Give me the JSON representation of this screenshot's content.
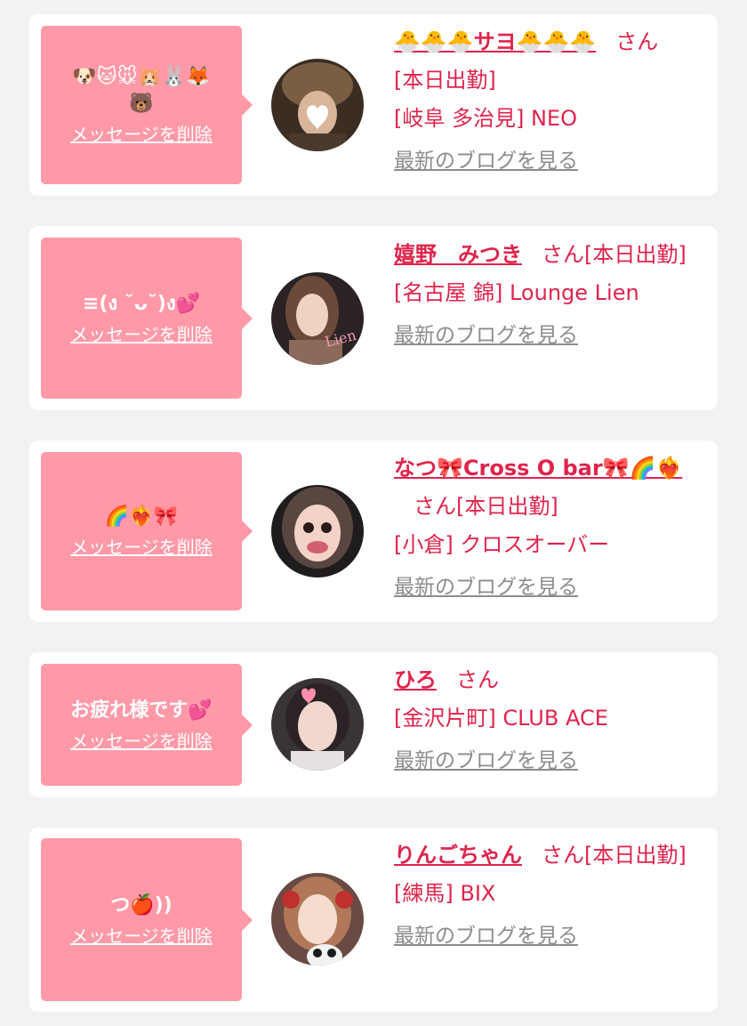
{
  "theme": {
    "accent": "#e0244c",
    "bubble": "#ff99a8",
    "card": "#ffffff",
    "background": "#f2f2f2",
    "muted_link": "#8c8c8c"
  },
  "labels": {
    "delete_message": "メッセージを削除",
    "honorific": "さん",
    "view_blog": "最新のブログを見る"
  },
  "cards": [
    {
      "message": "🐶🐱🐭🐹🐰🦊🐻",
      "name": "🐣🐣🐣サヨ🐣🐣🐣",
      "on_duty": "[本日出勤]",
      "shop": "[岐阜 多治見] NEO",
      "avatar_icon": "avatar-photo"
    },
    {
      "message": "≡(ง ˘ᴗ˘)ง💕",
      "name": "嬉野　みつき",
      "on_duty": "[本日出勤]",
      "shop": "[名古屋 錦] Lounge Lien",
      "avatar_icon": "avatar-photo"
    },
    {
      "message": "🌈❤️‍🔥🎀",
      "name": "なつ🎀Cross O bar🎀🌈❤️‍🔥",
      "on_duty": "[本日出勤]",
      "shop": "[小倉] クロスオーバー",
      "avatar_icon": "avatar-photo"
    },
    {
      "message": "お疲れ様です💕",
      "name": "ひろ",
      "on_duty": "",
      "shop": "[金沢片町] CLUB ACE",
      "avatar_icon": "avatar-photo"
    },
    {
      "message": "つ🍎))",
      "name": "りんごちゃん",
      "on_duty": "[本日出勤]",
      "shop": "[練馬] BIX",
      "avatar_icon": "avatar-photo"
    }
  ]
}
